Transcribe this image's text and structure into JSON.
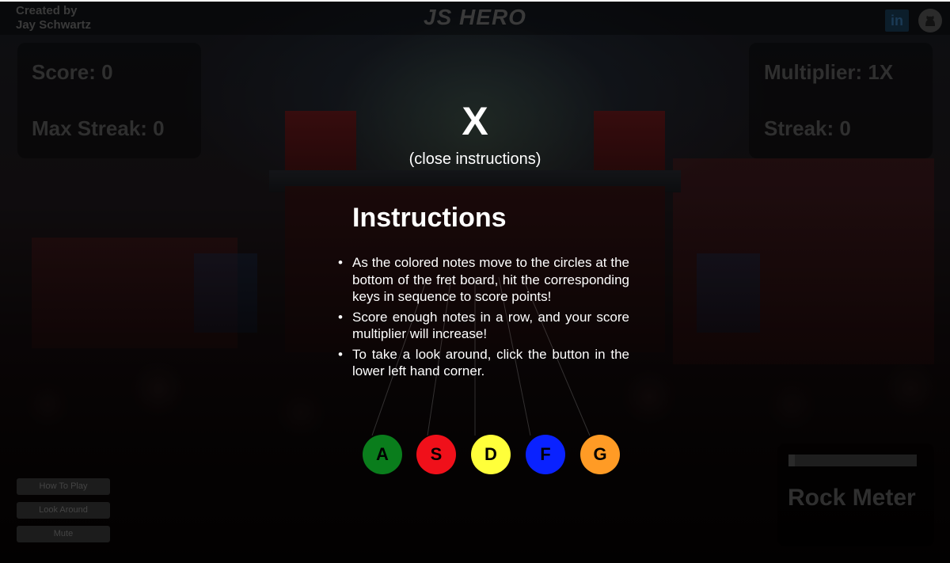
{
  "header": {
    "credit_line1": "Created by",
    "credit_line2": "Jay Schwartz",
    "logo": "JS HERO",
    "linkedin_label": "in",
    "github_icon": "github-icon"
  },
  "stats": {
    "score": "Score: 0",
    "max_streak": "Max Streak: 0",
    "multiplier": "Multiplier: 1X",
    "streak": "Streak: 0"
  },
  "sidebar": {
    "how_to_play": "How To Play",
    "look_around": "Look Around",
    "mute": "Mute"
  },
  "rock_meter": {
    "label": "Rock Meter",
    "level": 0.05
  },
  "overlay": {
    "close_x": "X",
    "close_text": "(close instructions)",
    "title": "Instructions",
    "items": [
      "As the colored notes move to the circles at the bottom of the fret board, hit the corresponding keys in sequence to score points!",
      "Score enough notes in a row, and your score multiplier will increase!",
      "To take a look around, click the button in the lower left hand corner."
    ],
    "bullet": "•"
  },
  "keys": [
    {
      "label": "A",
      "color": "#0a7d1c"
    },
    {
      "label": "S",
      "color": "#f0101a"
    },
    {
      "label": "D",
      "color": "#ffff3a"
    },
    {
      "label": "F",
      "color": "#0a22ff"
    },
    {
      "label": "G",
      "color": "#ff9b25"
    }
  ]
}
